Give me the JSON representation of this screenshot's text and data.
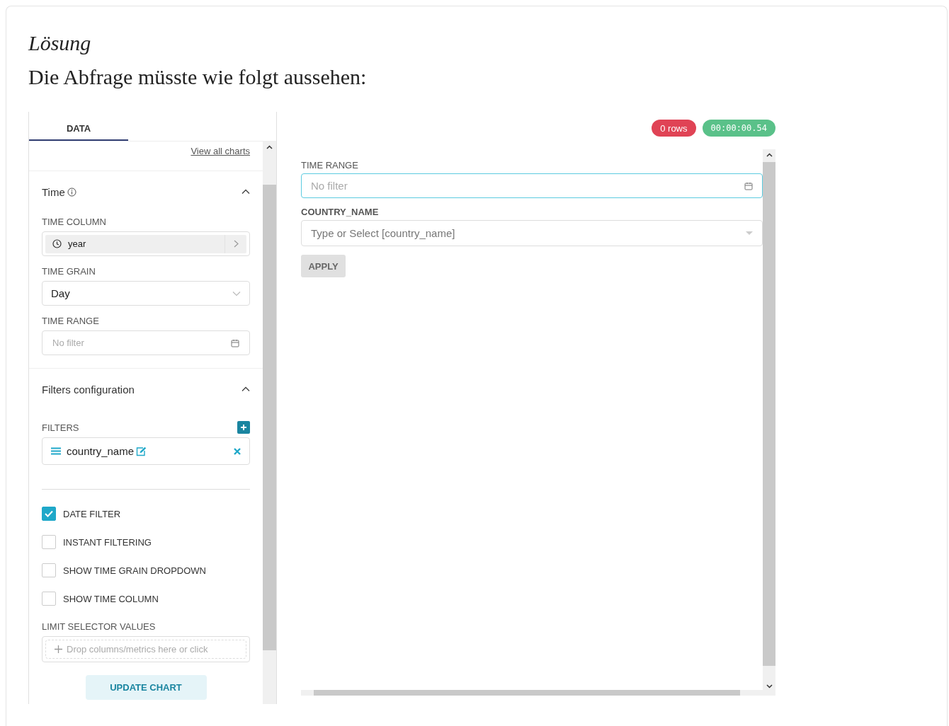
{
  "heading": "Lösung",
  "intro": "Die Abfrage müsste wie folgt aussehen:",
  "control_panel": {
    "tabs": [
      {
        "label": "DATA",
        "selected": true
      }
    ],
    "view_all_link": "View all charts",
    "sections": [
      {
        "title": "Time",
        "info_icon": true,
        "expanded": true,
        "controls": [
          {
            "kind": "column-select",
            "label": "TIME COLUMN",
            "value": "year"
          },
          {
            "kind": "select",
            "label": "TIME GRAIN",
            "value": "Day"
          },
          {
            "kind": "date-range",
            "label": "TIME RANGE",
            "placeholder": "No filter"
          }
        ]
      },
      {
        "title": "Filters configuration",
        "info_icon": false,
        "expanded": true,
        "controls": [
          {
            "kind": "filter-list",
            "label": "FILTERS",
            "items": [
              "country_name"
            ]
          },
          {
            "kind": "divider"
          },
          {
            "kind": "checkbox",
            "label": "DATE FILTER",
            "checked": true
          },
          {
            "kind": "checkbox",
            "label": "INSTANT FILTERING",
            "checked": false
          },
          {
            "kind": "checkbox",
            "label": "SHOW TIME GRAIN DROPDOWN",
            "checked": false
          },
          {
            "kind": "checkbox",
            "label": "SHOW TIME COLUMN",
            "checked": false
          },
          {
            "kind": "drop-area",
            "label": "LIMIT SELECTOR VALUES",
            "placeholder": "Drop columns/metrics here or click"
          }
        ]
      }
    ],
    "update_button": "UPDATE CHART"
  },
  "chart_panel": {
    "badges": [
      {
        "text": "0 rows",
        "color": "#e04355"
      },
      {
        "text": "00:00:00.54",
        "color": "#5ac189"
      }
    ],
    "filters": [
      {
        "kind": "date-range",
        "label": "TIME RANGE",
        "placeholder": "No filter"
      },
      {
        "kind": "select",
        "label": "COUNTRY_NAME",
        "placeholder": "Type or Select [country_name]"
      }
    ],
    "apply_button": "APPLY"
  }
}
